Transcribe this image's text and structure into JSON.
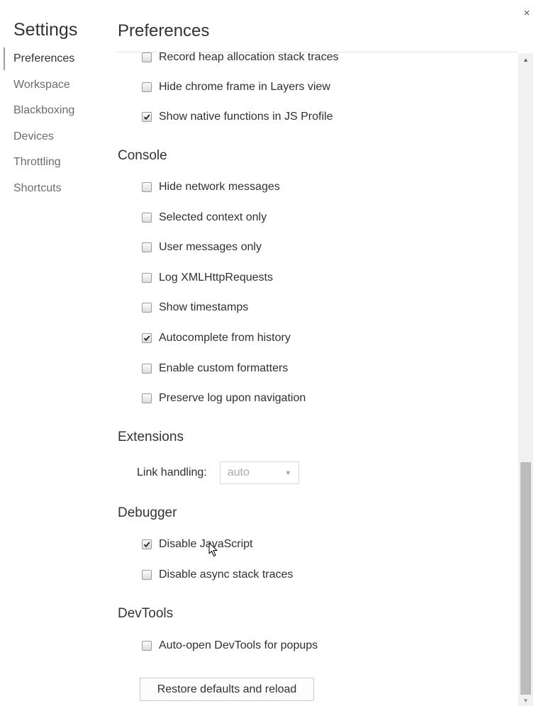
{
  "settings_title": "Settings",
  "sidebar": {
    "items": [
      {
        "label": "Preferences"
      },
      {
        "label": "Workspace"
      },
      {
        "label": "Blackboxing"
      },
      {
        "label": "Devices"
      },
      {
        "label": "Throttling"
      },
      {
        "label": "Shortcuts"
      }
    ],
    "active": "Preferences"
  },
  "page_title": "Preferences",
  "close_label": "×",
  "sections": {
    "profiler": {
      "options": [
        {
          "label": "Record heap allocation stack traces",
          "checked": false
        },
        {
          "label": "Hide chrome frame in Layers view",
          "checked": false
        },
        {
          "label": "Show native functions in JS Profile",
          "checked": true
        }
      ]
    },
    "console": {
      "title": "Console",
      "options": [
        {
          "label": "Hide network messages",
          "checked": false
        },
        {
          "label": "Selected context only",
          "checked": false
        },
        {
          "label": "User messages only",
          "checked": false
        },
        {
          "label": "Log XMLHttpRequests",
          "checked": false
        },
        {
          "label": "Show timestamps",
          "checked": false
        },
        {
          "label": "Autocomplete from history",
          "checked": true
        },
        {
          "label": "Enable custom formatters",
          "checked": false
        },
        {
          "label": "Preserve log upon navigation",
          "checked": false
        }
      ]
    },
    "extensions": {
      "title": "Extensions",
      "link_handling_label": "Link handling:",
      "link_handling_value": "auto"
    },
    "debugger": {
      "title": "Debugger",
      "options": [
        {
          "label": "Disable JavaScript",
          "checked": true
        },
        {
          "label": "Disable async stack traces",
          "checked": false
        }
      ]
    },
    "devtools": {
      "title": "DevTools",
      "options": [
        {
          "label": "Auto-open DevTools for popups",
          "checked": false
        }
      ]
    }
  },
  "restore_button_label": "Restore defaults and reload",
  "colors": {
    "text": "#303030",
    "muted_text": "#6c6c6c",
    "scroll_track": "#f1f1f1",
    "scroll_thumb": "#bcbcbc"
  }
}
